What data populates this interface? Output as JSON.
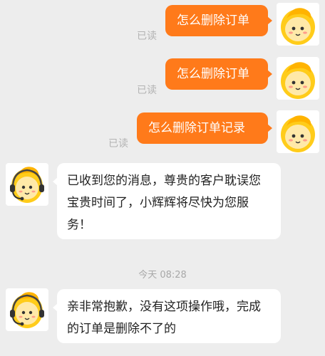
{
  "conversation": {
    "outgoing": [
      {
        "text": "怎么删除订单",
        "status": "已读"
      },
      {
        "text": "怎么删除订单",
        "status": "已读"
      },
      {
        "text": "怎么删除订单记录",
        "status": "已读"
      }
    ],
    "incoming": [
      {
        "text": "已收到您的消息，尊贵的客户耽误您宝贵时间了，小辉辉将尽快为您服务！"
      },
      {
        "text": "亲非常抱歉，没有这项操作哦，完成的订单是删除不了的"
      }
    ],
    "timestamp": "今天 08:28"
  },
  "colors": {
    "background": "#ededed",
    "outgoing_bubble": "#ff7a1a",
    "incoming_bubble": "#ffffff",
    "avatar_yellow": "#ffcc1a"
  },
  "icons": {
    "user_avatar": "yellow-mascot-avatar-icon",
    "agent_avatar": "yellow-mascot-headset-avatar-icon"
  }
}
